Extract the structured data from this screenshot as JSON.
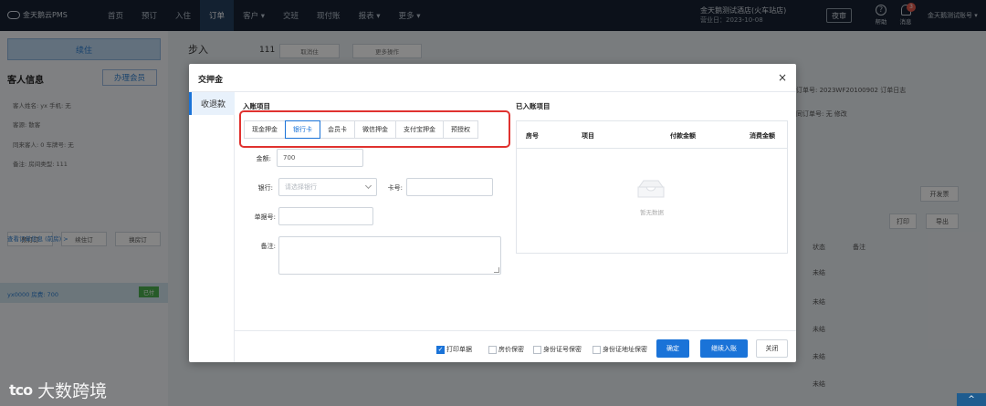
{
  "nav": {
    "logo": "金天鹅云PMS",
    "items": [
      "首页",
      "预订",
      "入住",
      "订单",
      "客户 ▾",
      "交班",
      "现付账",
      "报表 ▾",
      "更多 ▾"
    ],
    "active_index": 3,
    "hotel_name": "金天鹅测试酒店(火车站店)",
    "business_date": "营业日：2023-10-08",
    "shift_button": "夜审",
    "help": "帮助",
    "messages": "消息",
    "message_count": "3",
    "account": "金天鹅测试账号 ▾"
  },
  "background": {
    "left_top_button": "续住",
    "guest_info_title": "客人信息",
    "member_button": "办理会员",
    "rows": [
      "客人姓名: yx        手机: 无",
      "客源: 散客",
      "同来客人: 0        车牌号: 无",
      "备注: 房间类型: 111"
    ],
    "left_buttons": [
      "预订订",
      "续住订",
      "换房订"
    ],
    "link": "查看订单信息 (前房) >",
    "room_row": "yx0000  房费: 700",
    "room_status": "已付",
    "sub_title": "步入",
    "sub_num": "111",
    "sub_buttons": [
      "取消住",
      "更多操作"
    ],
    "order_no": "订单号: 2023WF20100902  订单日志",
    "order_no2": "同订单号: 无 修改",
    "right_buttons": [
      "开发票",
      "打印",
      "导出"
    ],
    "col_headers": [
      "状态",
      "备注"
    ],
    "col_value": "未结"
  },
  "modal": {
    "title": "交押金",
    "close": "×",
    "side_tab": "收退款",
    "entry_section_title": "入账项目",
    "entered_section_title": "已入账项目",
    "tabs": [
      "现金押金",
      "银行卡",
      "会员卡",
      "微信押金",
      "支付宝押金",
      "预授权"
    ],
    "active_tab": 1,
    "form": {
      "amount_label": "金额:",
      "amount_value": "700",
      "bank_label": "银行:",
      "bank_placeholder": "请选择银行",
      "card_label": "卡号:",
      "card_value": "",
      "receipt_label": "单据号:",
      "receipt_value": "",
      "remark_label": "备注:",
      "remark_value": ""
    },
    "table": {
      "headers": [
        "房号",
        "项目",
        "付款金额",
        "消费金额"
      ],
      "empty_text": "暂无数据"
    },
    "footer": {
      "checkboxes": [
        {
          "label": "打印单据",
          "checked": true
        },
        {
          "label": "房价保密",
          "checked": false
        },
        {
          "label": "身份证号保密",
          "checked": false
        },
        {
          "label": "身份证地址保密",
          "checked": false
        }
      ],
      "confirm": "确定",
      "continue": "继续入账",
      "close": "关闭"
    }
  },
  "watermark": "大数跨境",
  "watermark_logo": "tco",
  "colors": {
    "primary": "#1a73d8",
    "highlight_border": "#e0322f",
    "nav_bg": "#172232"
  }
}
